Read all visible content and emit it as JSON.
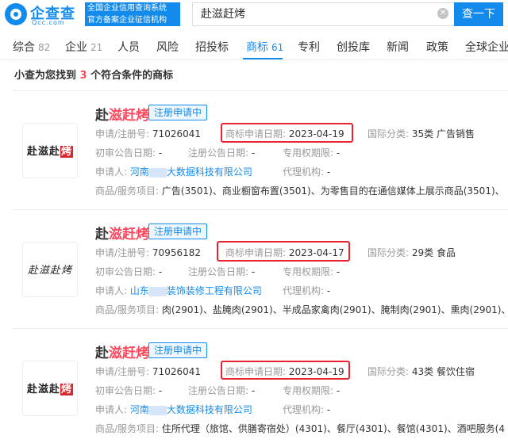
{
  "header": {
    "brand_name": "企查查",
    "brand_domain": "Qcc.com",
    "slogan_line1": "全国企业信用查询系统",
    "slogan_line2": "官方备案企业征信机构",
    "search_value": "赴滋赶烤",
    "clear_icon": "✕",
    "search_button": "查一下"
  },
  "tabs": [
    {
      "label": "综合",
      "count": "82"
    },
    {
      "label": "企业",
      "count": "21"
    },
    {
      "label": "人员",
      "count": ""
    },
    {
      "label": "风险",
      "count": ""
    },
    {
      "label": "招投标",
      "count": ""
    },
    {
      "label": "商标",
      "count": "61"
    },
    {
      "label": "专利",
      "count": ""
    },
    {
      "label": "创投库",
      "count": ""
    },
    {
      "label": "新闻",
      "count": ""
    },
    {
      "label": "政策",
      "count": ""
    },
    {
      "label": "全球企业",
      "count": ""
    }
  ],
  "summary": {
    "prefix": "小查为您找到",
    "count": "3",
    "suffix": "个符合条件的商标"
  },
  "labels": {
    "reg_no": "申请/注册号:",
    "apply_date": "商标申请日期:",
    "intl_class": "国际分类:",
    "first_pub": "初审公告日期:",
    "reg_pub": "注册公告日期:",
    "exclusive": "专用权期限:",
    "applicant": "申请人:",
    "agency": "代理机构:",
    "goods": "商品/服务项目:"
  },
  "results": [
    {
      "name_plain": "赴",
      "name_hl": "滋赶烤",
      "status": "注册申请中",
      "thumb_text": "赴滋赴",
      "thumb_red": "烤",
      "reg_no": "71026041",
      "apply_date": "2023-04-19",
      "intl_class": "35类 广告销售",
      "first_pub": "-",
      "reg_pub": "-",
      "exclusive": "-",
      "applicant_a": "河南",
      "applicant_b": "大数据科技有限公司",
      "agency": "-",
      "goods": "广告(3501)、商业橱窗布置(3501)、为零售目的在通信媒体上展示商品(3501)、"
    },
    {
      "name_plain": "赴",
      "name_hl": "滋赶烤",
      "status": "注册申请中",
      "thumb_text": "赴滋赴烤",
      "thumb_red": "",
      "reg_no": "70956182",
      "apply_date": "2023-04-17",
      "intl_class": "29类 食品",
      "first_pub": "-",
      "reg_pub": "-",
      "exclusive": "-",
      "applicant_a": "山东",
      "applicant_b": "装饰装修工程有限公司",
      "agency": "-",
      "goods": "肉(2901)、盐腌肉(2901)、半成品家禽肉(2901)、腌制肉(2901)、熏肉(2901)、"
    },
    {
      "name_plain": "赴",
      "name_hl": "滋赶烤",
      "status": "注册申请中",
      "thumb_text": "赴滋赴",
      "thumb_red": "烤",
      "reg_no": "71026041",
      "apply_date": "2023-04-19",
      "intl_class": "43类 餐饮住宿",
      "first_pub": "-",
      "reg_pub": "-",
      "exclusive": "-",
      "applicant_a": "河南",
      "applicant_b": "大数据科技有限公司",
      "agency": "-",
      "goods": "住所代理（旅馆、供膳寄宿处）(4301)、餐厅(4301)、餐馆(4301)、酒吧服务(4"
    }
  ]
}
